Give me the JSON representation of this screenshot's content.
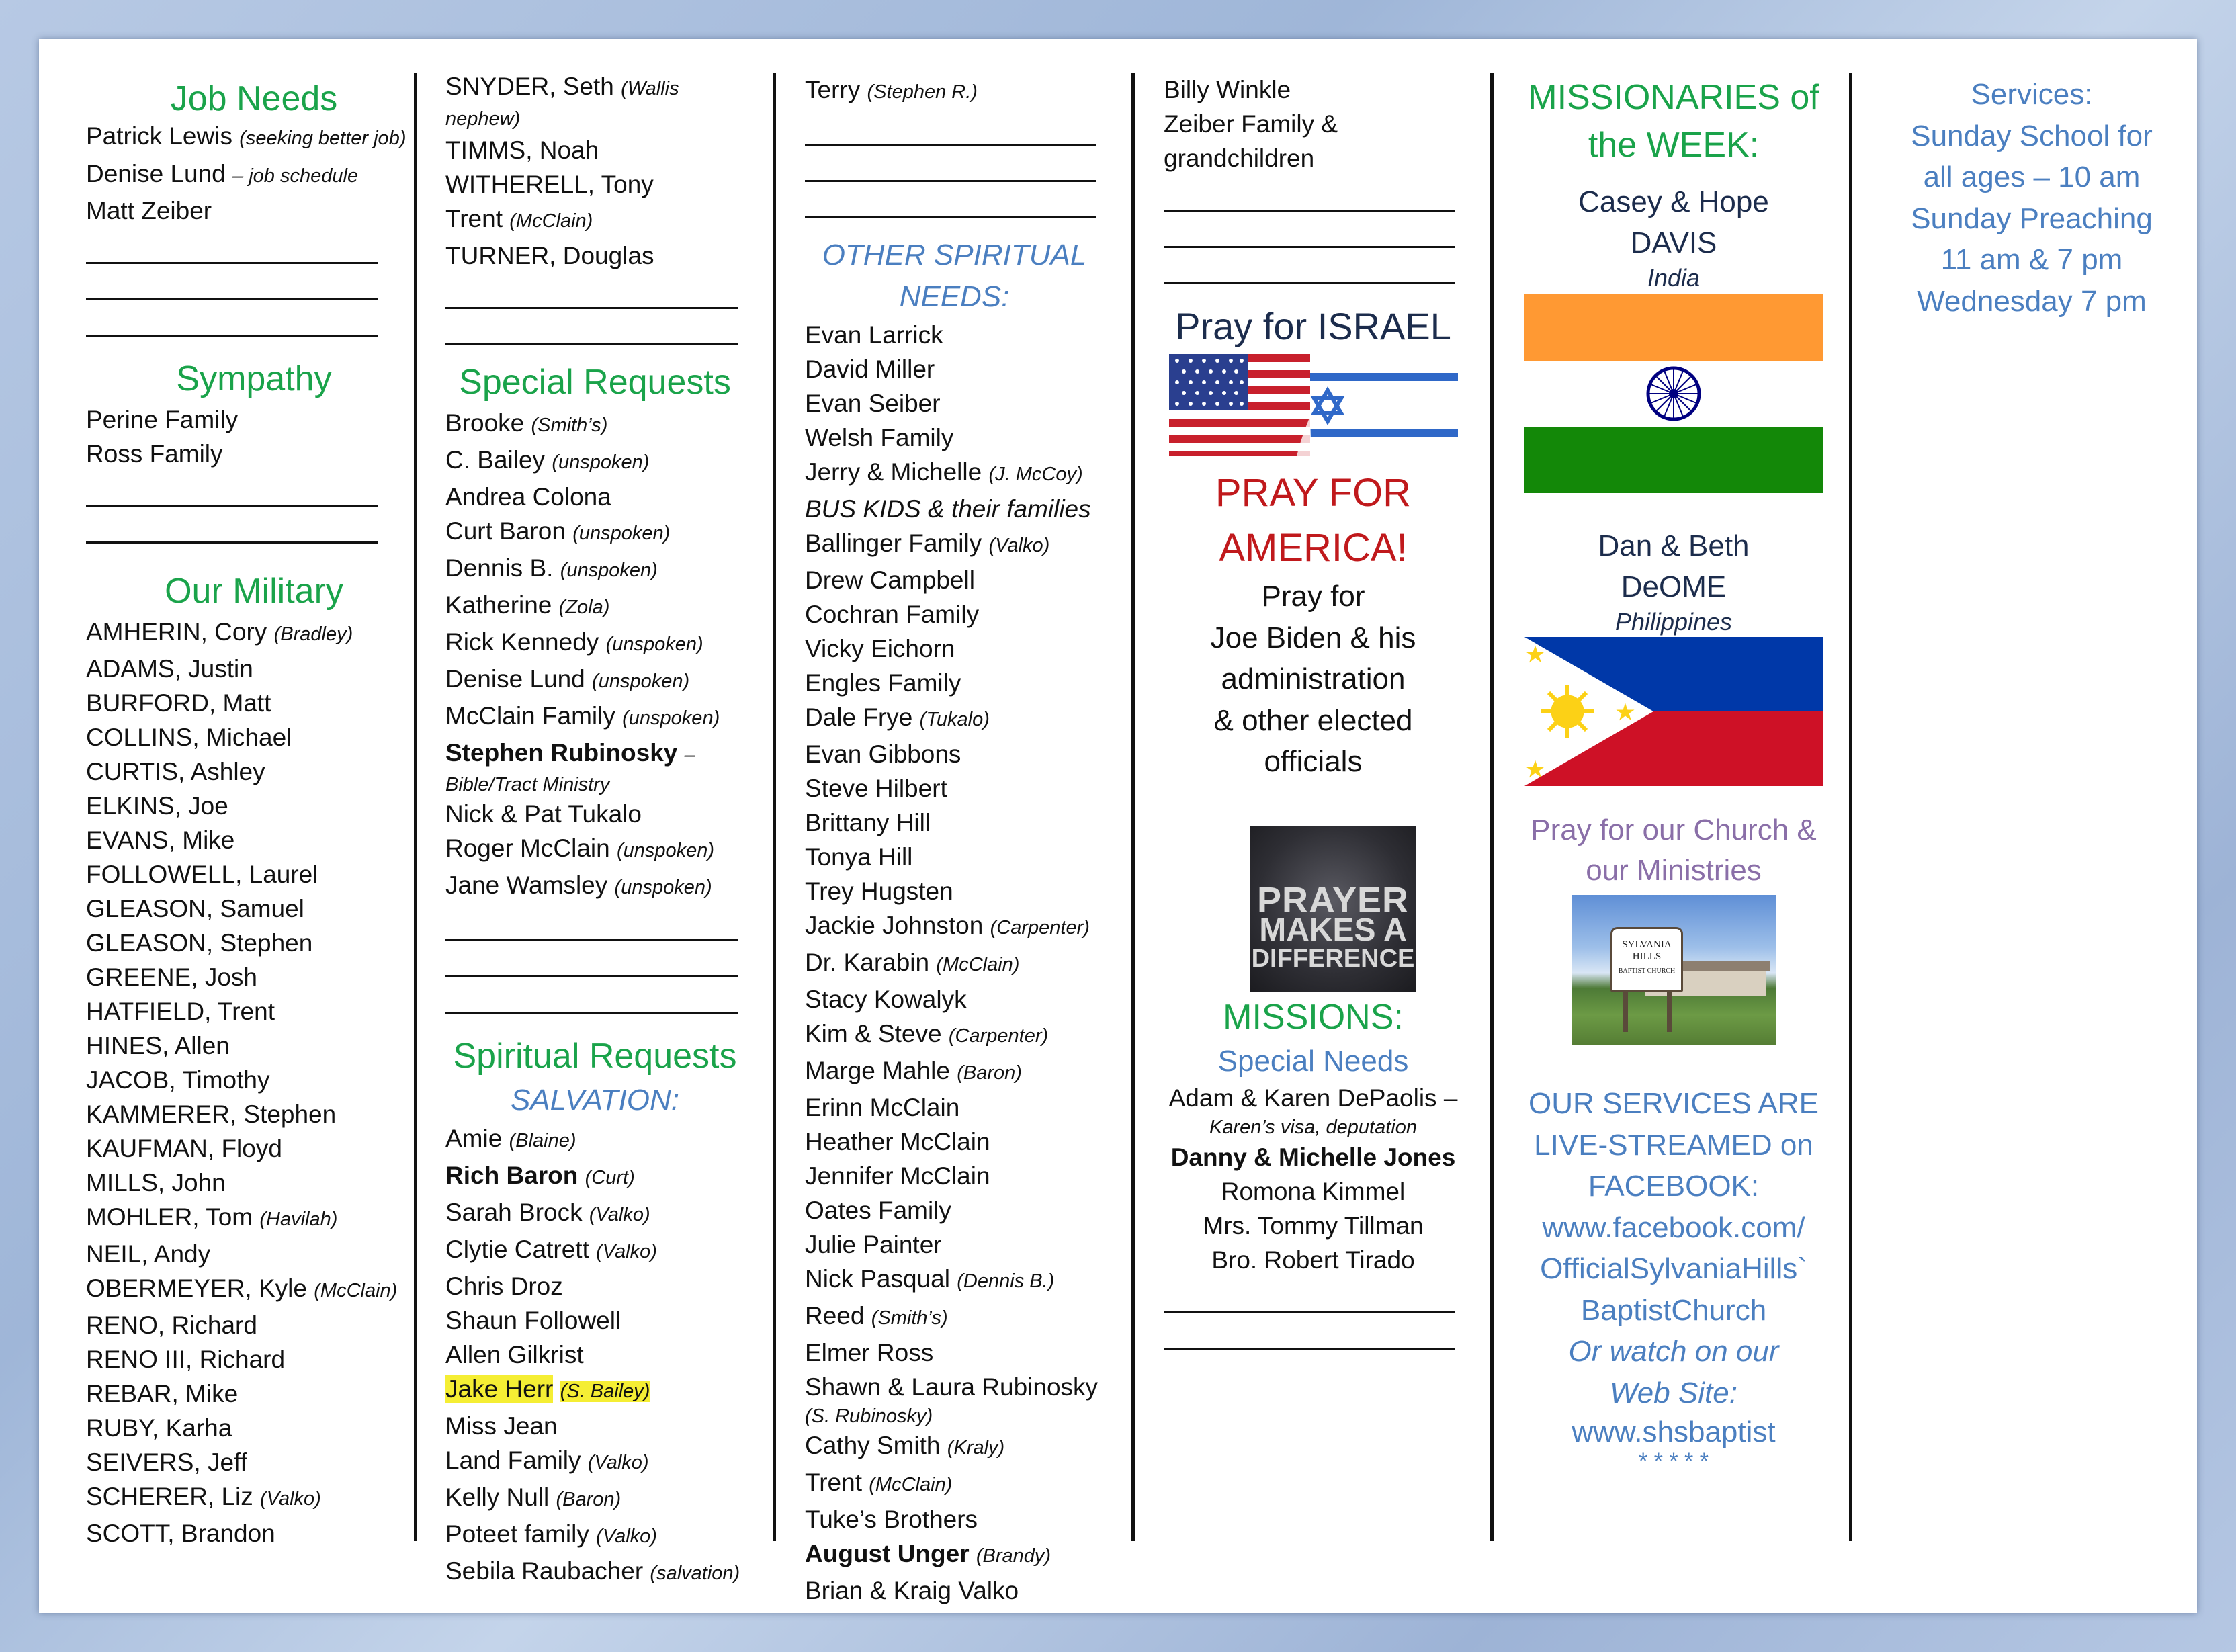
{
  "col1": {
    "job_needs_title": "Job Needs",
    "job_needs": [
      {
        "name": "Patrick Lewis",
        "note": "(seeking better job)"
      },
      {
        "name": "Denise Lund",
        "note": "– job schedule"
      },
      {
        "name": "Matt Zeiber",
        "note": ""
      }
    ],
    "sympathy_title": "Sympathy",
    "sympathy": [
      "Perine Family",
      "Ross Family"
    ],
    "military_title": "Our Military",
    "military": [
      {
        "name": "AMHERIN, Cory",
        "note": "(Bradley)"
      },
      {
        "name": "ADAMS, Justin",
        "note": ""
      },
      {
        "name": "BURFORD, Matt",
        "note": ""
      },
      {
        "name": "COLLINS, Michael",
        "note": ""
      },
      {
        "name": "CURTIS, Ashley",
        "note": ""
      },
      {
        "name": "ELKINS, Joe",
        "note": ""
      },
      {
        "name": "EVANS, Mike",
        "note": ""
      },
      {
        "name": "FOLLOWELL, Laurel",
        "note": ""
      },
      {
        "name": "GLEASON, Samuel",
        "note": ""
      },
      {
        "name": "GLEASON, Stephen",
        "note": ""
      },
      {
        "name": "GREENE, Josh",
        "note": ""
      },
      {
        "name": "HATFIELD, Trent",
        "note": ""
      },
      {
        "name": "HINES, Allen",
        "note": ""
      },
      {
        "name": "JACOB, Timothy",
        "note": ""
      },
      {
        "name": "KAMMERER, Stephen",
        "note": ""
      },
      {
        "name": "KAUFMAN, Floyd",
        "note": ""
      },
      {
        "name": "MILLS, John",
        "note": ""
      },
      {
        "name": "MOHLER, Tom",
        "note": "(Havilah)"
      },
      {
        "name": "NEIL, Andy",
        "note": ""
      },
      {
        "name": "OBERMEYER, Kyle",
        "note": "(McClain)"
      },
      {
        "name": "RENO, Richard",
        "note": ""
      },
      {
        "name": "RENO III, Richard",
        "note": ""
      },
      {
        "name": "REBAR, Mike",
        "note": ""
      },
      {
        "name": "RUBY, Karha",
        "note": ""
      },
      {
        "name": "SEIVERS, Jeff",
        "note": ""
      },
      {
        "name": "SCHERER, Liz",
        "note": "(Valko)"
      },
      {
        "name": "SCOTT, Brandon",
        "note": ""
      }
    ]
  },
  "col2": {
    "military_cont": [
      {
        "name": "SNYDER, Seth",
        "note": "(Wallis nephew)"
      },
      {
        "name": "TIMMS, Noah",
        "note": ""
      },
      {
        "name": "WITHERELL, Tony",
        "note": ""
      },
      {
        "name": "Trent",
        "note": "(McClain)"
      },
      {
        "name": "TURNER, Douglas",
        "note": ""
      }
    ],
    "special_title": "Special Requests",
    "special": [
      {
        "name": "Brooke",
        "note": "(Smith’s)"
      },
      {
        "name": "C. Bailey",
        "note": "(unspoken)"
      },
      {
        "name": "Andrea Colona",
        "note": ""
      },
      {
        "name": "Curt Baron",
        "note": "(unspoken)"
      },
      {
        "name": "Dennis B.",
        "note": "(unspoken)"
      },
      {
        "name": "Katherine",
        "note": "(Zola)"
      },
      {
        "name": "Rick Kennedy",
        "note": "(unspoken)"
      },
      {
        "name": "Denise Lund",
        "note": "(unspoken)"
      },
      {
        "name": "McClain Family",
        "note": "(unspoken)"
      },
      {
        "name": "Stephen Rubinosky",
        "note": "–",
        "sub": "Bible/Tract Ministry",
        "bold": true
      },
      {
        "name": "Nick & Pat Tukalo",
        "note": ""
      },
      {
        "name": "Roger McClain",
        "note": "(unspoken)"
      },
      {
        "name": "Jane Wamsley",
        "note": "(unspoken)"
      }
    ],
    "spiritual_title": "Spiritual Requests",
    "salvation_title": "SALVATION:",
    "salvation": [
      {
        "name": "Amie",
        "note": "(Blaine)"
      },
      {
        "name": "Rich Baron",
        "note": "(Curt)",
        "bold": true
      },
      {
        "name": "Sarah Brock",
        "note": "(Valko)"
      },
      {
        "name": "Clytie Catrett",
        "note": "(Valko)"
      },
      {
        "name": "Chris Droz",
        "note": ""
      },
      {
        "name": "Shaun Followell",
        "note": ""
      },
      {
        "name": "Allen Gilkrist",
        "note": ""
      },
      {
        "name": "Jake Herr",
        "note": "(S. Bailey)",
        "highlight": true
      },
      {
        "name": "Miss Jean",
        "note": ""
      },
      {
        "name": "Land Family",
        "note": "(Valko)"
      },
      {
        "name": "Kelly Null",
        "note": "(Baron)"
      },
      {
        "name": "Poteet family",
        "note": "(Valko)"
      },
      {
        "name": "Sebila Raubacher",
        "note": "(salvation)"
      }
    ]
  },
  "col3": {
    "top": [
      {
        "name": "Terry",
        "note": "(Stephen R.)"
      }
    ],
    "other_title_1": "OTHER SPIRITUAL",
    "other_title_2": "NEEDS:",
    "other": [
      {
        "name": "Evan Larrick",
        "note": ""
      },
      {
        "name": "David Miller",
        "note": ""
      },
      {
        "name": "Evan Seiber",
        "note": ""
      },
      {
        "name": "Welsh Family",
        "note": ""
      },
      {
        "name": "Jerry & Michelle",
        "note": "(J. McCoy)"
      },
      {
        "name": "BUS KIDS & their families",
        "note": "",
        "italic": true
      },
      {
        "name": "Ballinger Family",
        "note": "(Valko)"
      },
      {
        "name": "Drew Campbell",
        "note": ""
      },
      {
        "name": "Cochran Family",
        "note": ""
      },
      {
        "name": "Vicky Eichorn",
        "note": ""
      },
      {
        "name": "Engles Family",
        "note": ""
      },
      {
        "name": "Dale Frye",
        "note": "(Tukalo)"
      },
      {
        "name": "Evan Gibbons",
        "note": ""
      },
      {
        "name": "Steve Hilbert",
        "note": ""
      },
      {
        "name": "Brittany Hill",
        "note": ""
      },
      {
        "name": "Tonya Hill",
        "note": ""
      },
      {
        "name": "Trey Hugsten",
        "note": ""
      },
      {
        "name": "Jackie Johnston",
        "note": "(Carpenter)"
      },
      {
        "name": "Dr. Karabin",
        "note": "(McClain)"
      },
      {
        "name": "Stacy Kowalyk",
        "note": ""
      },
      {
        "name": "Kim & Steve",
        "note": "(Carpenter)"
      },
      {
        "name": "Marge Mahle",
        "note": "(Baron)"
      },
      {
        "name": "Erinn McClain",
        "note": ""
      },
      {
        "name": "Heather McClain",
        "note": ""
      },
      {
        "name": "Jennifer McClain",
        "note": ""
      },
      {
        "name": "Oates Family",
        "note": ""
      },
      {
        "name": "Julie Painter",
        "note": ""
      },
      {
        "name": "Nick Pasqual",
        "note": "(Dennis B.)"
      },
      {
        "name": "Reed",
        "note": "(Smith’s)"
      },
      {
        "name": "Elmer Ross",
        "note": ""
      },
      {
        "name": "Shawn & Laura Rubinosky",
        "note": "",
        "sub": "(S. Rubinosky)"
      },
      {
        "name": "Cathy Smith",
        "note": "(Kraly)"
      },
      {
        "name": "Trent",
        "note": "(McClain)"
      },
      {
        "name": "Tuke’s Brothers",
        "note": ""
      },
      {
        "name": "August Unger",
        "note": "(Brandy)",
        "bold": true
      },
      {
        "name": "Brian & Kraig Valko",
        "note": ""
      }
    ]
  },
  "col4": {
    "top": [
      "Billy Winkle",
      "Zeiber Family &",
      "grandchildren"
    ],
    "israel": "Pray for ISRAEL",
    "america_1": "PRAY FOR",
    "america_2": "AMERICA!",
    "pray_lines": [
      "Pray for",
      "Joe Biden & his",
      "administration",
      "& other elected",
      "officials"
    ],
    "poster": [
      "PRAYER",
      "MAKES A",
      "DIFFERENCE"
    ],
    "missions_title": "MISSIONS:",
    "special_needs": "Special Needs",
    "missions": [
      {
        "name": "Adam & Karen DePaolis –",
        "sub": "Karen’s visa, deputation"
      },
      {
        "name": "Danny & Michelle Jones",
        "bold": true
      },
      {
        "name": "Romona Kimmel"
      },
      {
        "name": "Mrs. Tommy Tillman"
      },
      {
        "name": "Bro. Robert Tirado"
      }
    ]
  },
  "col5": {
    "title_1": "MISSIONARIES of",
    "title_2": "the WEEK:",
    "m1_names": "Casey & Hope",
    "m1_last": "DAVIS",
    "m1_country": "India",
    "m2_names": "Dan & Beth",
    "m2_last": "DeOME",
    "m2_country": "Philippines",
    "church_1": "Pray for our Church &",
    "church_2": "our Ministries",
    "sign": [
      "SYLVANIA",
      "HILLS",
      "BAPTIST CHURCH"
    ],
    "live": [
      "OUR SERVICES ARE",
      "LIVE-STREAMED on",
      "FACEBOOK:",
      "www.facebook.com/",
      "OfficialSylvaniaHills`",
      "BaptistChurch"
    ],
    "watch": [
      "Or watch on our",
      "Web Site:"
    ],
    "website": "www.shsbaptist",
    "stars": "* * * * *"
  },
  "col6": {
    "lines": [
      "Services:",
      "Sunday School for",
      "all ages – 10 am",
      "Sunday Preaching",
      "11 am & 7 pm",
      "Wednesday 7 pm"
    ]
  },
  "colors": {
    "green": "#1aa34a",
    "blue": "#4b7fc0",
    "red": "#c0191c",
    "purple": "#8a6fa8",
    "highlight": "#f5ee34"
  }
}
